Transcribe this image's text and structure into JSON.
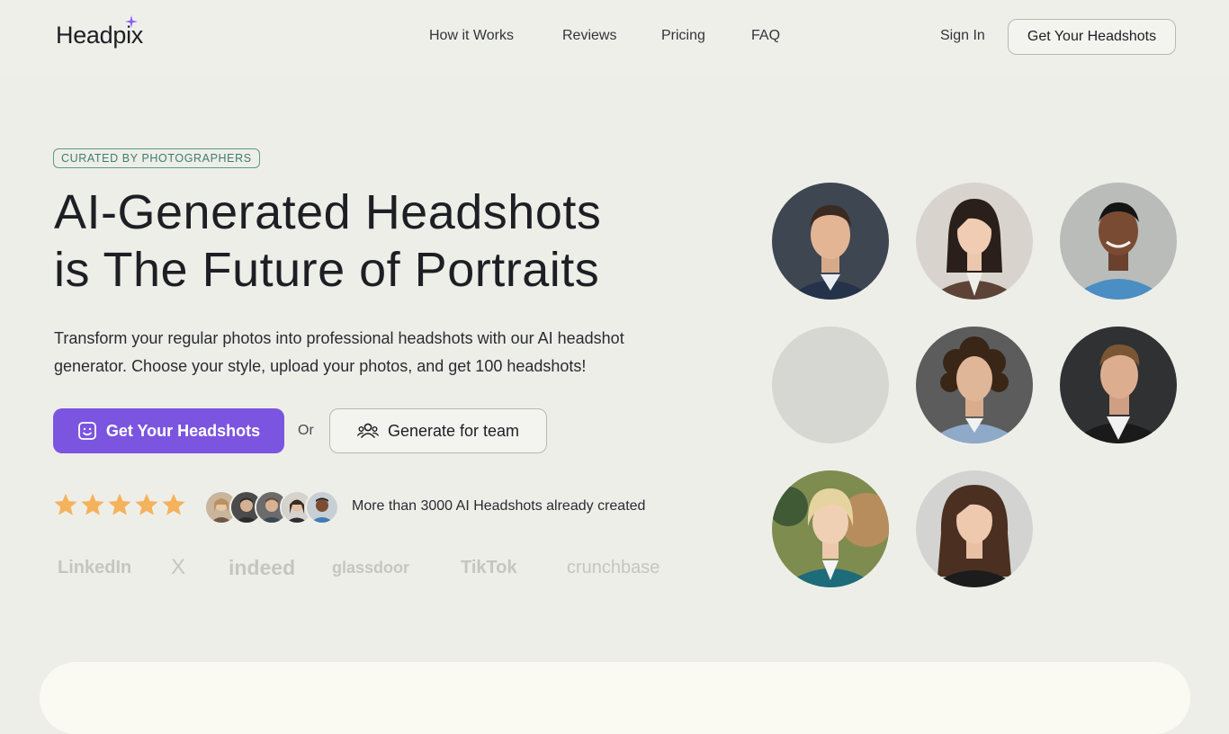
{
  "brand": {
    "name": "Headpix"
  },
  "nav": {
    "items": [
      {
        "label": "How it Works"
      },
      {
        "label": "Reviews"
      },
      {
        "label": "Pricing"
      },
      {
        "label": "FAQ"
      }
    ],
    "sign_in": "Sign In",
    "cta": "Get Your Headshots"
  },
  "hero": {
    "badge": "CURATED BY PHOTOGRAPHERS",
    "headline_line1": "AI-Generated Headshots",
    "headline_line2": "is The Future of Portraits",
    "subtext": "Transform your regular photos into professional headshots with our AI headshot generator. Choose your style, upload your photos, and get 100 headshots!",
    "primary_cta": "Get Your Headshots",
    "or_text": "Or",
    "secondary_cta": "Generate for team",
    "rating_stars": 5,
    "social_proof": "More than 3000 AI Headshots already created"
  },
  "logos": [
    "LinkedIn",
    "X",
    "indeed",
    "glassdoor",
    "TikTok",
    "crunchbase"
  ],
  "colors": {
    "accent": "#7b55e0",
    "badge": "#3d7c6c",
    "star": "#f5b25c",
    "background": "#eeeee9"
  }
}
